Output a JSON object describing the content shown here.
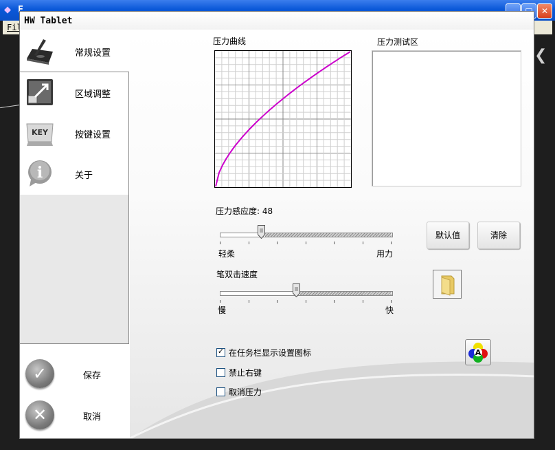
{
  "background_window": {
    "title": "F",
    "menu_file": "Fil",
    "min_label": "_",
    "max_label": "□",
    "close_label": "✕"
  },
  "dialog": {
    "title": "HW Tablet"
  },
  "sidebar": {
    "general": "常规设置",
    "area": "区域调整",
    "keys": "按键设置",
    "key_icon_text": "KEY",
    "about": "关于",
    "about_icon_text": "i",
    "save": "保存",
    "cancel": "取消"
  },
  "pressure": {
    "curve_label": "压力曲线",
    "test_label": "压力测试区",
    "sensitivity_label": "压力感应度: 48",
    "sensitivity_value": 48,
    "sensitivity_fraction": 0.24,
    "soft_label": "轻柔",
    "hard_label": "用力",
    "default_button": "默认值",
    "clear_button": "清除"
  },
  "double_click": {
    "label": "笔双击速度",
    "speed_fraction": 0.445,
    "slow_label": "慢",
    "fast_label": "快"
  },
  "options": [
    {
      "label": "在任务栏显示设置图标",
      "checked": true
    },
    {
      "label": "禁止右键",
      "checked": false
    },
    {
      "label": "取消压力",
      "checked": false
    }
  ],
  "colors": {
    "curve": "#cc00cc",
    "accent": "#0a58d8"
  }
}
